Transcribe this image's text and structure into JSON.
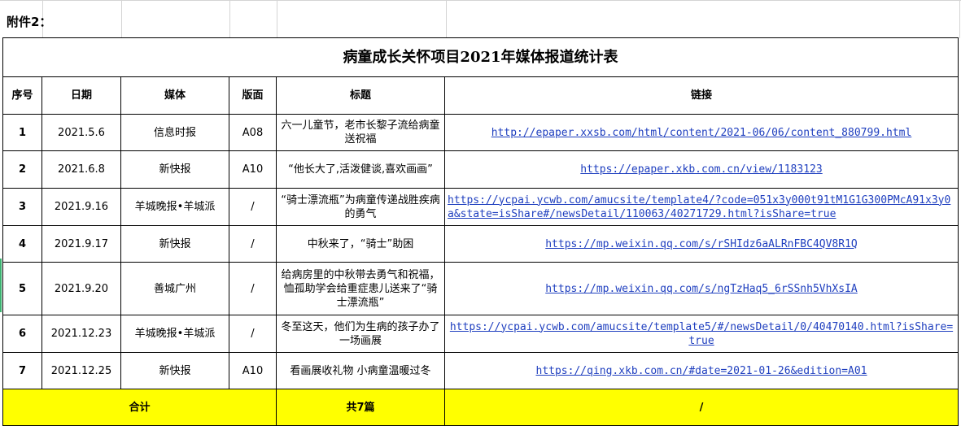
{
  "attachment_label": "附件2：",
  "table": {
    "title": "病童成长关怀项目2021年媒体报道统计表",
    "headers": {
      "no": "序号",
      "date": "日期",
      "media": "媒体",
      "page": "版面",
      "title": "标题",
      "link": "链接"
    },
    "rows": [
      {
        "no": "1",
        "date": "2021.5.6",
        "media": "信息时报",
        "page": "A08",
        "title": "六一儿童节，老市长黎子流给病童送祝福",
        "link": "http://epaper.xxsb.com/html/content/2021-06/06/content_880799.html"
      },
      {
        "no": "2",
        "date": "2021.6.8",
        "media": "新快报",
        "page": "A10",
        "title": "“他长大了,活泼健谈,喜欢画画”",
        "link": "https://epaper.xkb.com.cn/view/1183123"
      },
      {
        "no": "3",
        "date": "2021.9.16",
        "media": "羊城晚报•羊城派",
        "page": "/",
        "title": "“骑士漂流瓶”为病童传递战胜疾病的勇气",
        "link": "https://ycpai.ycwb.com/amucsite/template4/?code=051x3y000t91tM1G1G300PMcA91x3y0a&state=isShare#/newsDetail/110063/40271729.html?isShare=true"
      },
      {
        "no": "4",
        "date": "2021.9.17",
        "media": "新快报",
        "page": "/",
        "title": "中秋来了，“骑士”助困",
        "link": "https://mp.weixin.qq.com/s/rSHIdz6aALRnFBC4QV8R1Q"
      },
      {
        "no": "5",
        "date": "2021.9.20",
        "media": "善城广州",
        "page": "/",
        "title": "给病房里的中秋带去勇气和祝福，恤孤助学会给重症患儿送来了“骑士漂流瓶”",
        "link": "https://mp.weixin.qq.com/s/ngTzHaq5_6rSSnh5VhXsIA"
      },
      {
        "no": "6",
        "date": "2021.12.23",
        "media": "羊城晚报•羊城派",
        "page": "/",
        "title": "冬至这天，他们为生病的孩子办了一场画展",
        "link": "https://ycpai.ycwb.com/amucsite/template5/#/newsDetail/0/40470140.html?isShare=true"
      },
      {
        "no": "7",
        "date": "2021.12.25",
        "media": "新快报",
        "page": "A10",
        "title": "看画展收礼物 小病童温暖过冬",
        "link": "https://qing.xkb.com.cn/#date=2021-01-26&edition=A01"
      }
    ],
    "total": {
      "label": "合计",
      "count": "共7篇",
      "link": "/"
    },
    "colors": {
      "total_bg": "#ffff00",
      "link": "#1f3fbf"
    }
  }
}
